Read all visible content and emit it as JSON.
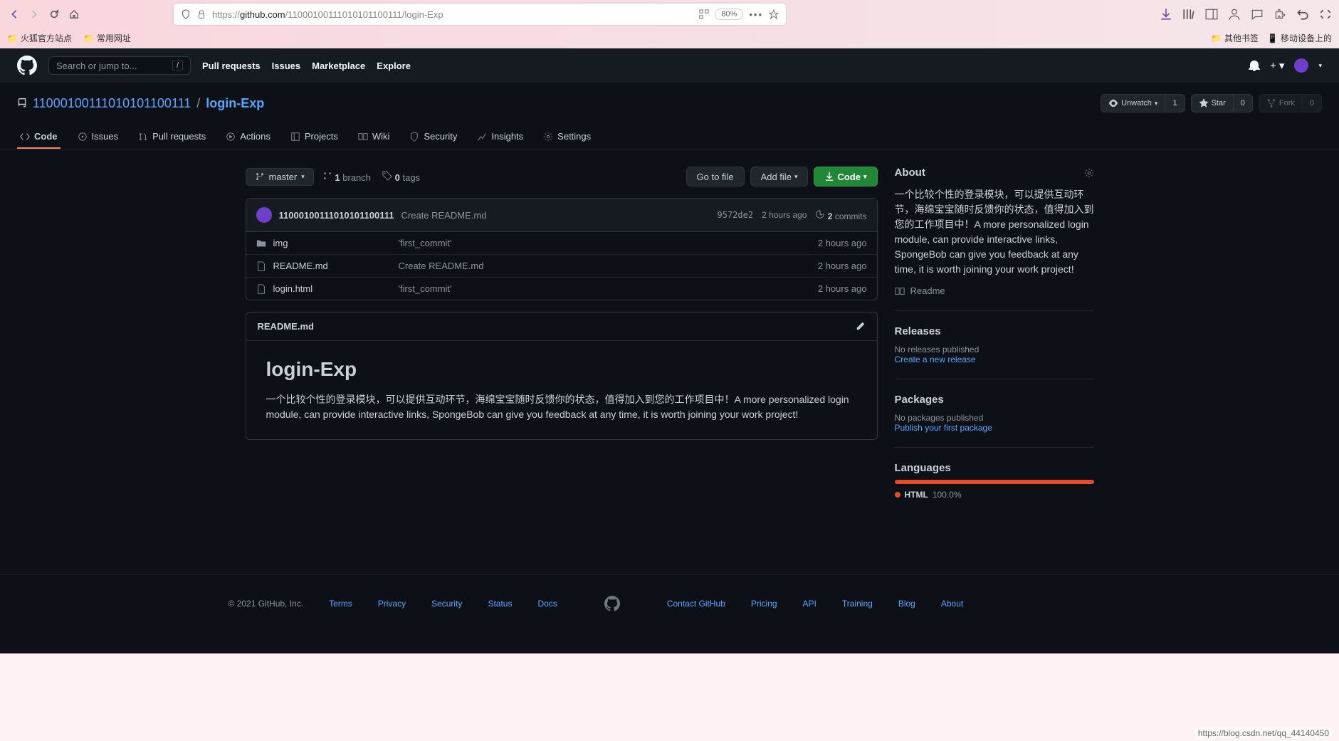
{
  "browser": {
    "url_prefix": "https://",
    "url_domain": "github.com",
    "url_path": "/11000100111010101100111/login-Exp",
    "zoom": "80%",
    "bookmarks": {
      "b1": "火狐官方站点",
      "b2": "常用网址",
      "r1": "其他书签",
      "r2": "移动设备上的"
    }
  },
  "gh_header": {
    "search_placeholder": "Search or jump to...",
    "slash": "/",
    "nav": {
      "pulls": "Pull requests",
      "issues": "Issues",
      "marketplace": "Marketplace",
      "explore": "Explore"
    }
  },
  "repo": {
    "owner": "11000100111010101100111",
    "sep": "/",
    "name": "login-Exp",
    "actions": {
      "unwatch_label": "Unwatch",
      "unwatch_count": "1",
      "star_label": "Star",
      "star_count": "0",
      "fork_label": "Fork",
      "fork_count": "0"
    },
    "tabs": {
      "code": "Code",
      "issues": "Issues",
      "pulls": "Pull requests",
      "actions": "Actions",
      "projects": "Projects",
      "wiki": "Wiki",
      "security": "Security",
      "insights": "Insights",
      "settings": "Settings"
    }
  },
  "filenav": {
    "branch": "master",
    "branches_num": "1",
    "branches_label": "branch",
    "tags_num": "0",
    "tags_label": "tags",
    "goto": "Go to file",
    "addfile": "Add file",
    "code": "Code"
  },
  "commit": {
    "author": "11000100111010101100111",
    "message": "Create README.md",
    "sha": "9572de2",
    "time": "2 hours ago",
    "count_num": "2",
    "count_label": "commits"
  },
  "files": [
    {
      "name": "img",
      "msg": "'first_commit'",
      "time": "2 hours ago",
      "type": "dir"
    },
    {
      "name": "README.md",
      "msg": "Create README.md",
      "time": "2 hours ago",
      "type": "file"
    },
    {
      "name": "login.html",
      "msg": "'first_commit'",
      "time": "2 hours ago",
      "type": "file"
    }
  ],
  "readme": {
    "filename": "README.md",
    "title": "login-Exp",
    "body": "一个比较个性的登录模块，可以提供互动环节，海绵宝宝随时反馈你的状态，值得加入到您的工作项目中！A more personalized login module, can provide interactive links, SpongeBob can give you feedback at any time, it is worth joining your work project!"
  },
  "sidebar": {
    "about_title": "About",
    "about_desc": "一个比较个性的登录模块，可以提供互动环节，海绵宝宝随时反馈你的状态，值得加入到您的工作项目中！A more personalized login module, can provide interactive links, SpongeBob can give you feedback at any time, it is worth joining your work project!",
    "readme_link": "Readme",
    "releases_title": "Releases",
    "releases_empty": "No releases published",
    "releases_create": "Create a new release",
    "packages_title": "Packages",
    "packages_empty": "No packages published",
    "packages_create": "Publish your first package",
    "languages_title": "Languages",
    "lang_name": "HTML",
    "lang_pct": "100.0%"
  },
  "footer": {
    "copyright": "© 2021 GitHub, Inc.",
    "links": {
      "terms": "Terms",
      "privacy": "Privacy",
      "security": "Security",
      "status": "Status",
      "docs": "Docs",
      "contact": "Contact GitHub",
      "pricing": "Pricing",
      "api": "API",
      "training": "Training",
      "blog": "Blog",
      "about": "About"
    }
  },
  "watermark": "https://blog.csdn.net/qq_44140450"
}
